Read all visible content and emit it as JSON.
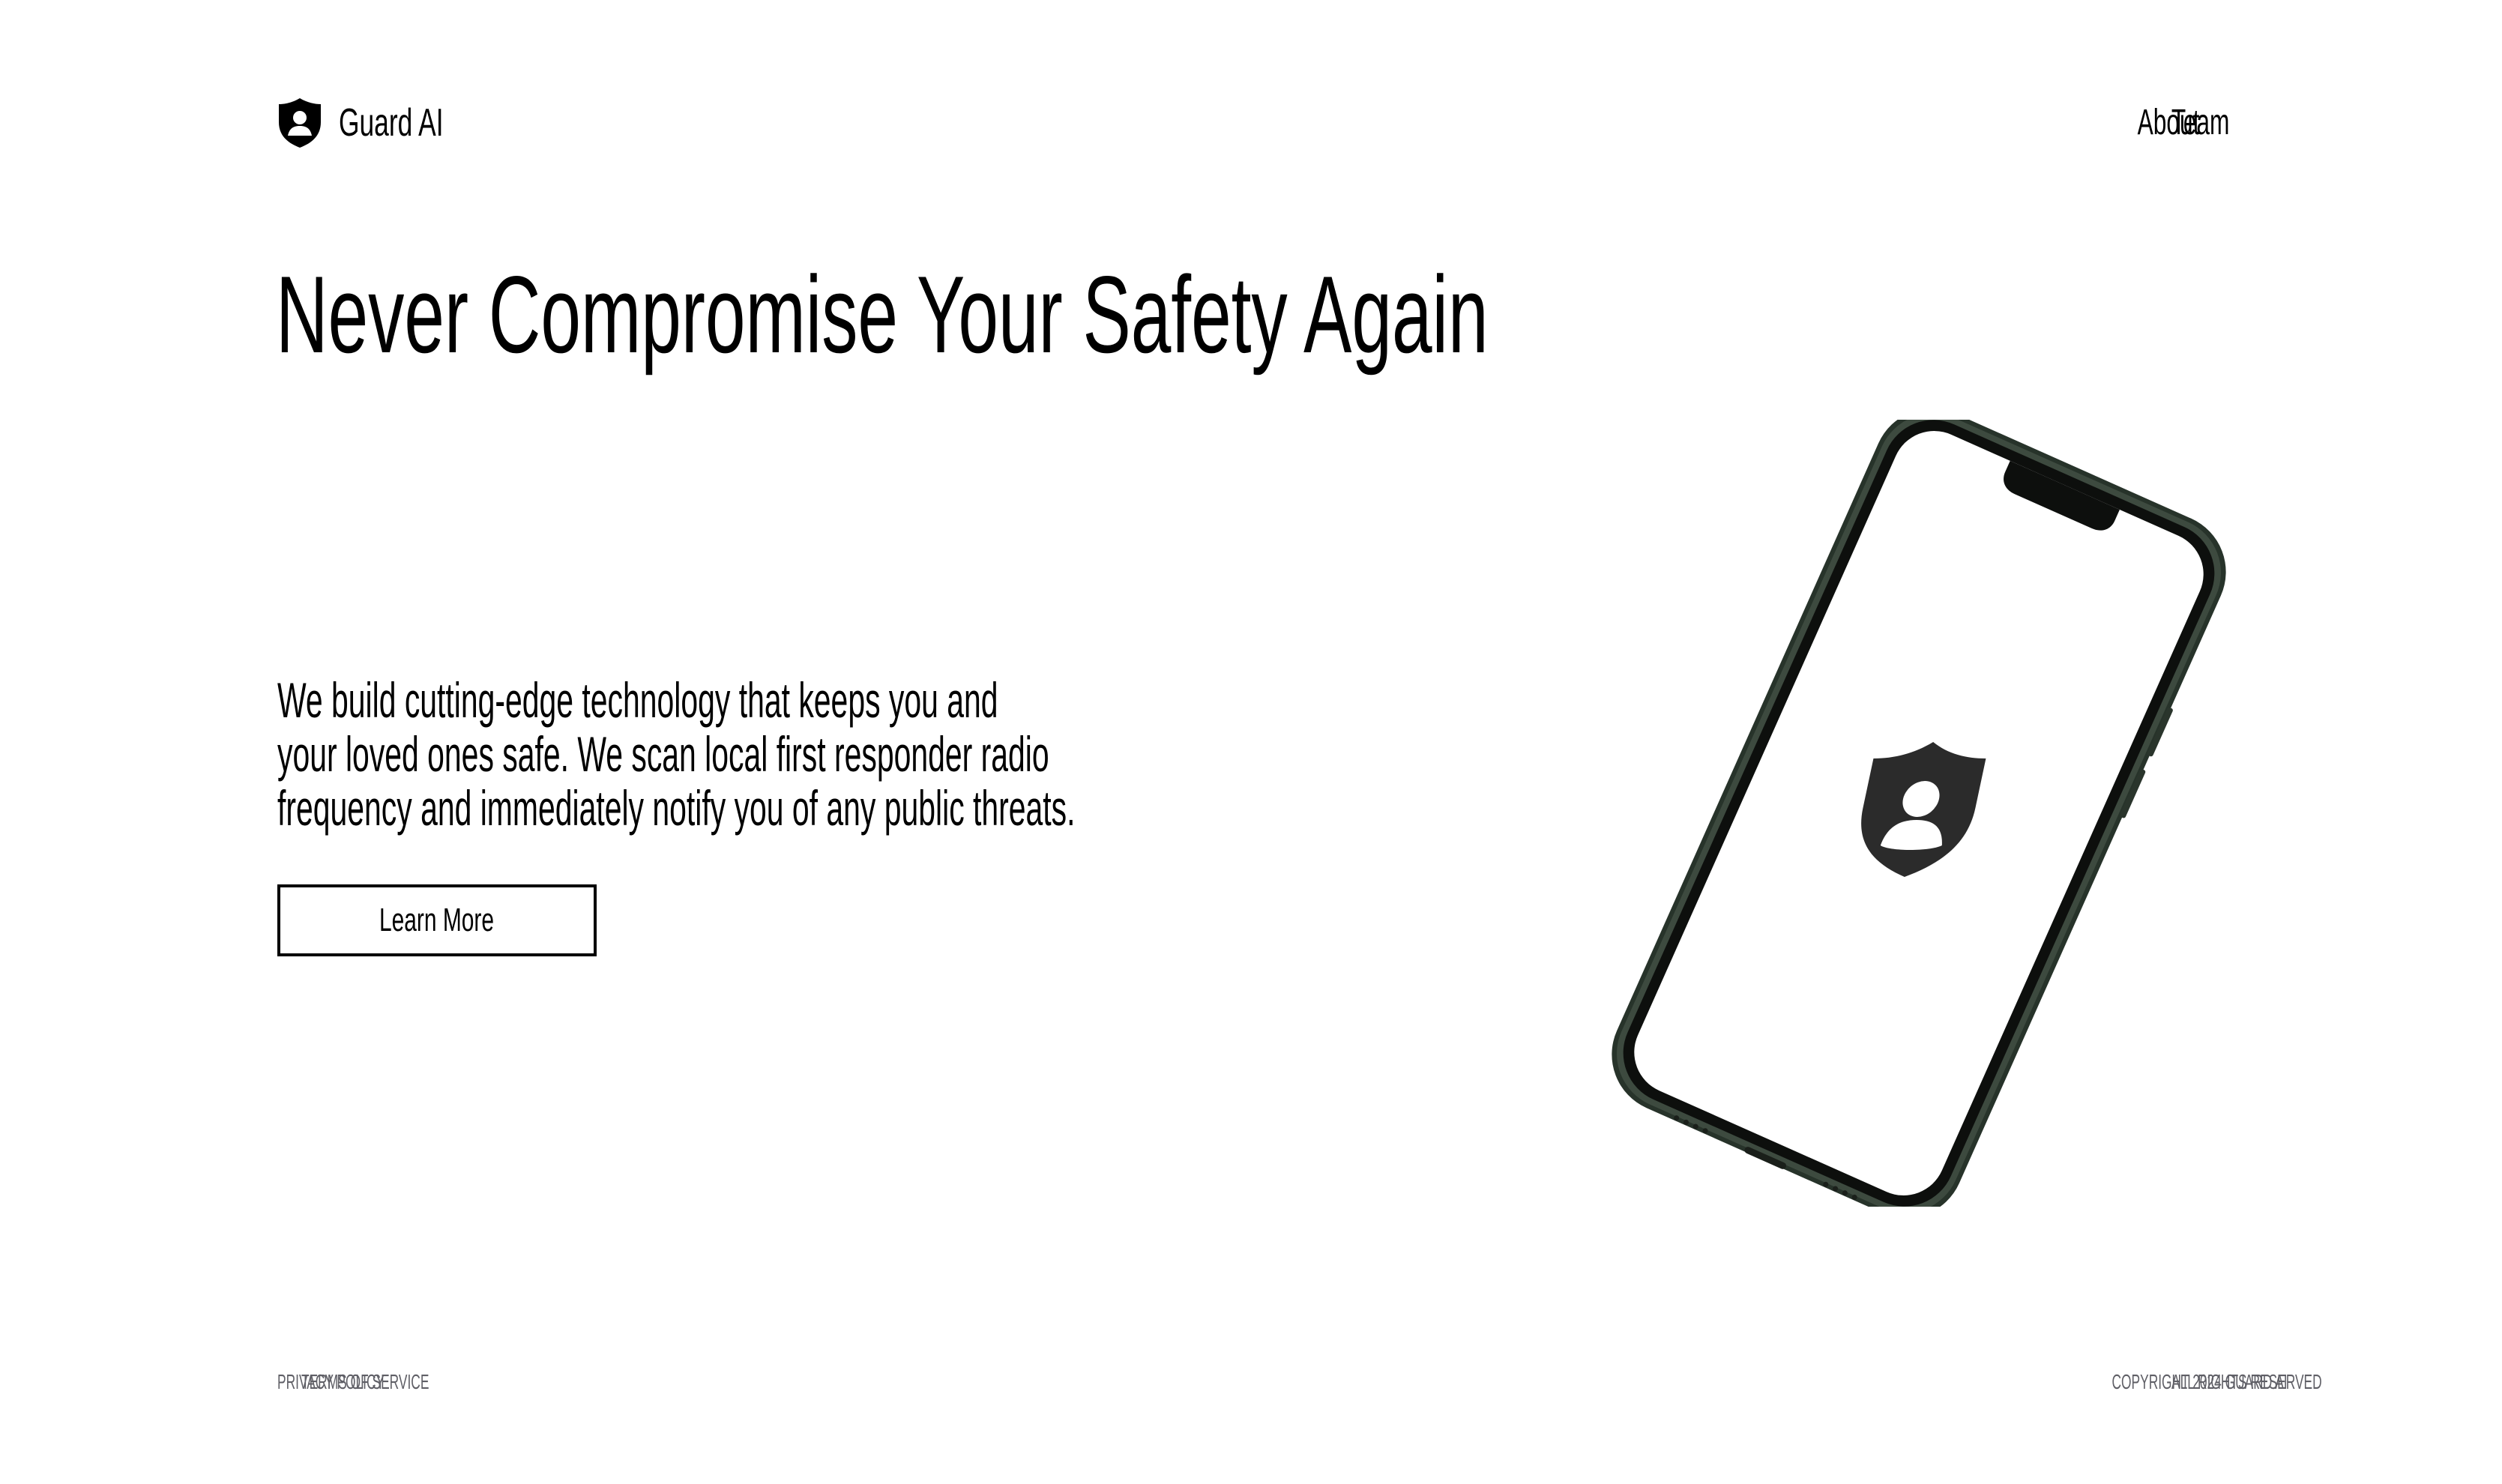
{
  "brand": {
    "name": "Guard AI",
    "icon": "shield-user-icon"
  },
  "nav": {
    "about": "About",
    "team": "Team"
  },
  "hero": {
    "title": "Never Compromise Your Safety Again",
    "text_lines": [
      "We build cutting-edge technology that keeps you and",
      "your loved ones safe. We scan local first responder radio",
      "frequency and immediately notify you of any public threats."
    ],
    "cta": "Learn More"
  },
  "phone": {
    "screen_icon": "shield-user-icon"
  },
  "footer": {
    "privacy": "PRIVACY POLICY",
    "terms": "TERMS OF SERVICE",
    "copyright": "COPYRIGHT 2024 GUARD AI",
    "rights": "ALL RIGHTS RESERVED"
  },
  "colors": {
    "text": "#000000",
    "background": "#ffffff",
    "footer_text": "#5f5f66",
    "phone_frame": "#2f3a2f"
  }
}
